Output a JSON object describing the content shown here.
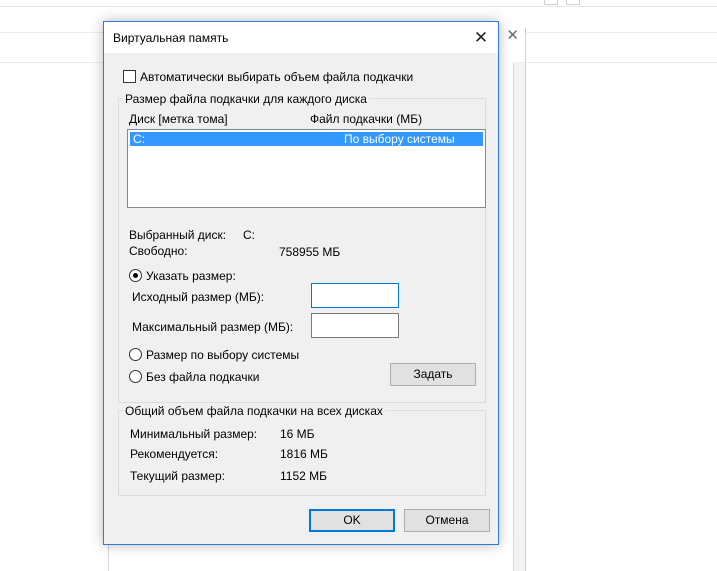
{
  "dialog": {
    "title": "Виртуальная память",
    "close_glyph": "✕"
  },
  "auto_manage": {
    "label": "Автоматически выбирать объем файла подкачки",
    "checked": false
  },
  "per_drive": {
    "group_label": "Размер файла подкачки для каждого диска",
    "columns": [
      "Диск [метка тома]",
      "Файл подкачки (МБ)"
    ],
    "drives": [
      {
        "drive": "C:",
        "paging": "По выбору системы",
        "selected": true
      }
    ],
    "selected_drive_label": "Выбранный диск:",
    "selected_drive_value": "C:",
    "free_label": "Свободно:",
    "free_value": "758955 МБ",
    "custom_size_label": "Указать размер:",
    "initial_size_label": "Исходный размер (МБ):",
    "initial_size_value": "",
    "max_size_label": "Максимальный размер (МБ):",
    "max_size_value": "",
    "system_managed_label": "Размер по выбору системы",
    "no_paging_label": "Без файла подкачки",
    "selected_option": "custom",
    "set_button": "Задать"
  },
  "total": {
    "group_label": "Общий объем файла подкачки на всех дисках",
    "min_label": "Минимальный размер:",
    "min_value": "16 МБ",
    "recommended_label": "Рекомендуется:",
    "recommended_value": "1816 МБ",
    "current_label": "Текущий размер:",
    "current_value": "1152 МБ"
  },
  "buttons": {
    "ok": "OK",
    "cancel": "Отмена"
  },
  "background_window": {
    "close_glyph": "✕"
  },
  "colors": {
    "accent": "#0078d7",
    "selection": "#3399ff",
    "dialog_bg": "#f0f0f0"
  }
}
